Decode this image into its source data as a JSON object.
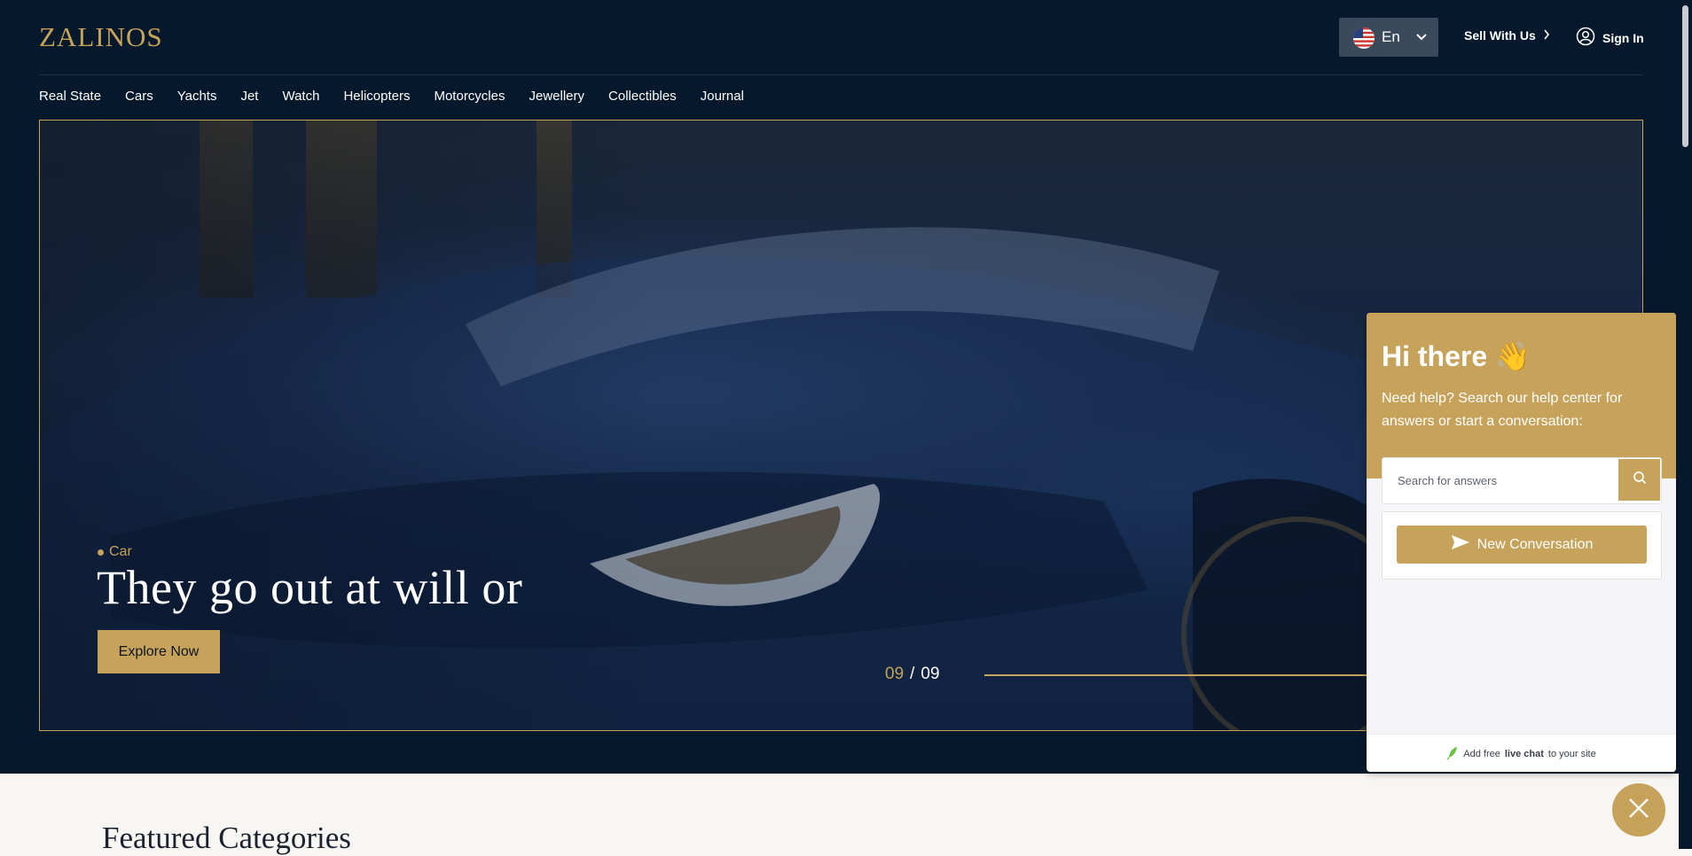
{
  "header": {
    "logo": "ZALINOS",
    "language": "En",
    "language_icon": "us-flag-icon",
    "sell_label": "Sell With Us",
    "signin_label": "Sign In"
  },
  "nav": {
    "items": [
      "Real State",
      "Cars",
      "Yachts",
      "Jet",
      "Watch",
      "Helicopters",
      "Motorcycles",
      "Jewellery",
      "Collectibles",
      "Journal"
    ]
  },
  "hero": {
    "category": "Car",
    "headline": "They go out at will or",
    "cta_label": "Explore Now",
    "pager_current": "09",
    "pager_separator": "/",
    "pager_total": "09"
  },
  "featured": {
    "title": "Featured Categories"
  },
  "chat": {
    "title": "Hi there 👋",
    "subtitle": "Need help? Search our help center for answers or start a conversation:",
    "search_placeholder": "Search for answers",
    "new_conversation_label": "New Conversation",
    "footer_prefix": "Add free",
    "footer_bold": "live chat",
    "footer_suffix": "to your site"
  },
  "colors": {
    "accent": "#c6a25a",
    "dark": "#06192c",
    "light_bg": "#f7f6f2"
  }
}
